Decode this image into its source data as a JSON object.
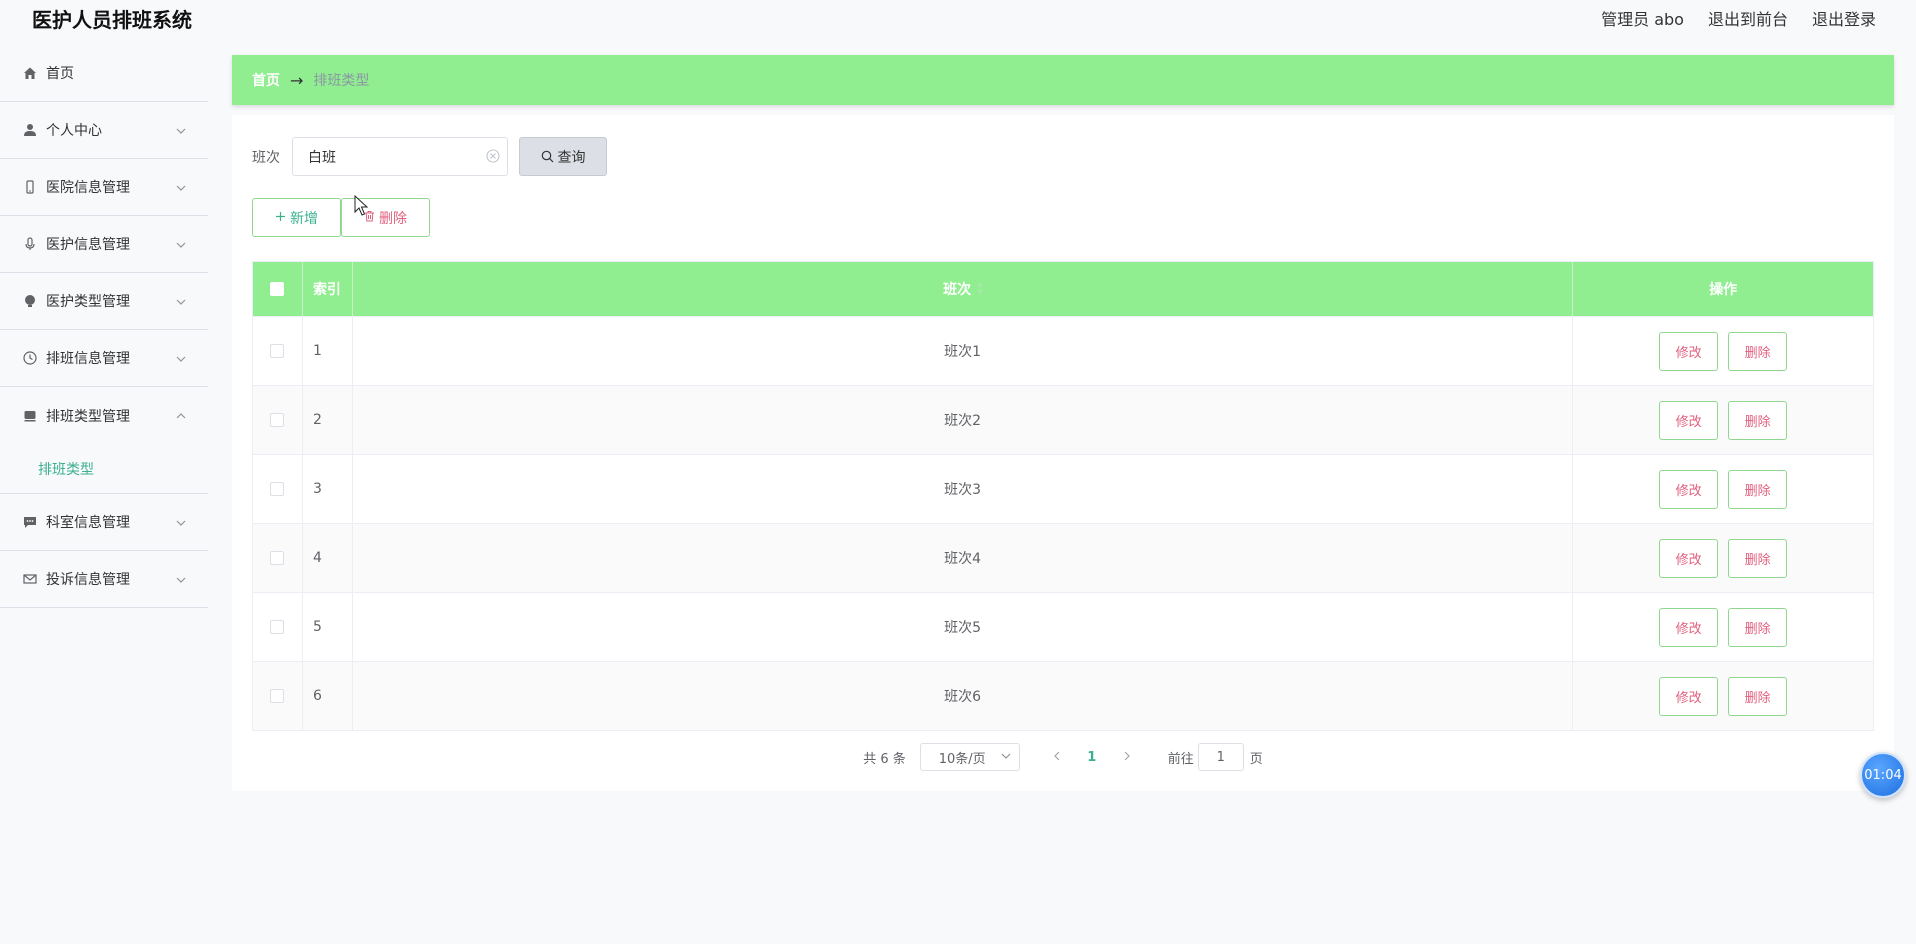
{
  "header": {
    "title": "医护人员排班系统",
    "user_label": "管理员 abo",
    "to_front_label": "退出到前台",
    "logout_label": "退出登录"
  },
  "sidebar": {
    "items": [
      {
        "label": "首页",
        "icon": "home-icon",
        "has_children": false
      },
      {
        "label": "个人中心",
        "icon": "user-icon",
        "has_children": true
      },
      {
        "label": "医院信息管理",
        "icon": "phone-icon",
        "has_children": true
      },
      {
        "label": "医护信息管理",
        "icon": "microphone-icon",
        "has_children": true
      },
      {
        "label": "医护类型管理",
        "icon": "bulb-icon",
        "has_children": true
      },
      {
        "label": "排班信息管理",
        "icon": "clock-icon",
        "has_children": true
      },
      {
        "label": "排班类型管理",
        "icon": "box-icon",
        "has_children": true,
        "open": true,
        "children": [
          {
            "label": "排班类型"
          }
        ]
      },
      {
        "label": "科室信息管理",
        "icon": "chat-icon",
        "has_children": true
      },
      {
        "label": "投诉信息管理",
        "icon": "mail-icon",
        "has_children": true
      }
    ]
  },
  "breadcrumb": {
    "home": "首页",
    "arrow": "→",
    "current": "排班类型"
  },
  "search": {
    "label": "班次",
    "value": "白班",
    "button_label": "查询"
  },
  "actions": {
    "add_label": "新增",
    "delete_label": "删除"
  },
  "table": {
    "headers": {
      "index": "索引",
      "shift": "班次",
      "operation": "操作"
    },
    "edit_label": "修改",
    "delete_label": "删除",
    "rows": [
      {
        "index": "1",
        "shift": "班次1"
      },
      {
        "index": "2",
        "shift": "班次2"
      },
      {
        "index": "3",
        "shift": "班次3"
      },
      {
        "index": "4",
        "shift": "班次4"
      },
      {
        "index": "5",
        "shift": "班次5"
      },
      {
        "index": "6",
        "shift": "班次6"
      }
    ]
  },
  "pagination": {
    "total": "共 6 条",
    "page_size": "10条/页",
    "current_page": "1",
    "goto_label": "前往",
    "goto_value": "1",
    "page_unit": "页"
  },
  "timer": {
    "value": "01:04"
  },
  "colors": {
    "accent_green": "#90ee90",
    "link_green": "#3bb08f",
    "danger_pink": "#e0607e"
  }
}
